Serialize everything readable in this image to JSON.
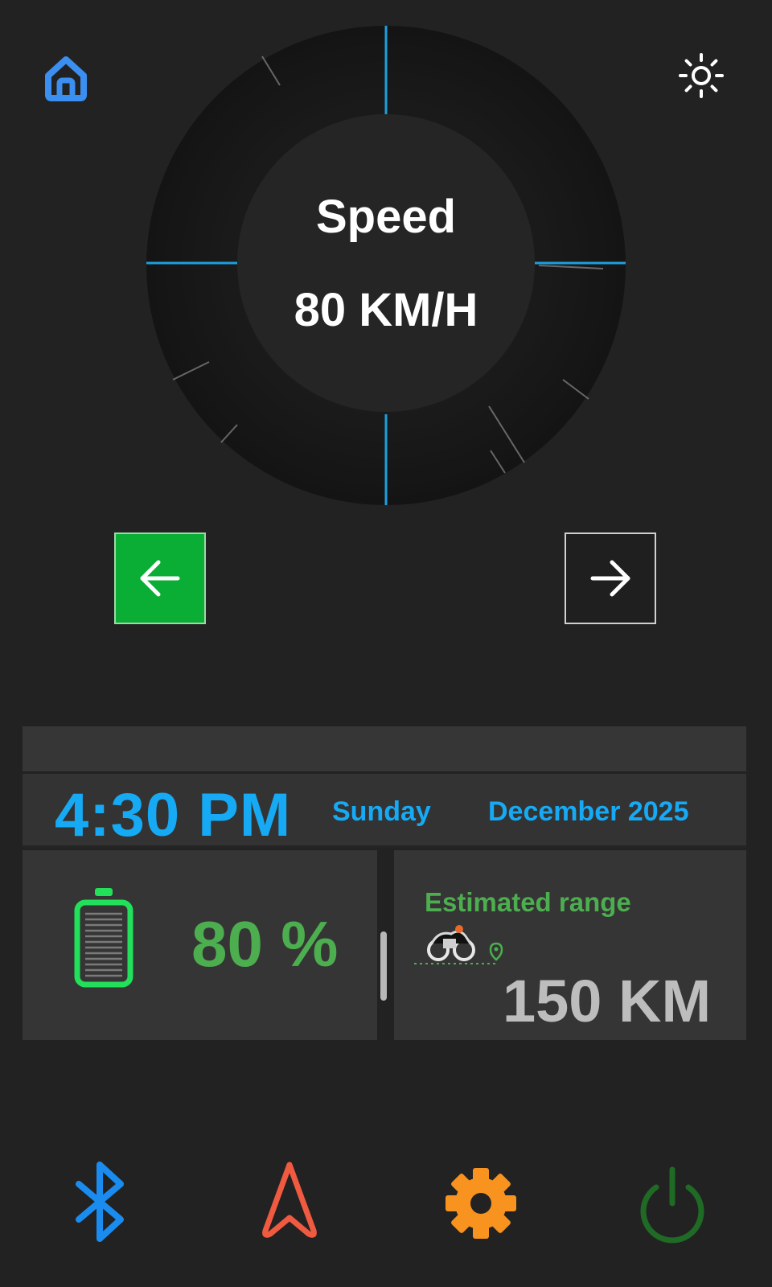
{
  "header": {
    "home_icon": "home-icon",
    "brightness_icon": "sun-icon",
    "accent": "#3b8ff0"
  },
  "speedometer": {
    "label": "Speed",
    "value": "80 KM/H",
    "tick_color": "#1aa0e0"
  },
  "turn_signals": {
    "left": {
      "icon": "arrow-left-icon",
      "active": true,
      "color": "#0aae35"
    },
    "right": {
      "icon": "arrow-right-icon",
      "active": false
    }
  },
  "clock": {
    "time": "4:30 PM",
    "day": "Sunday",
    "date": "December 2025",
    "color": "#16aaf5"
  },
  "battery": {
    "icon": "battery-icon",
    "value": "80 %",
    "level": 0.8,
    "color": "#4cae4f"
  },
  "range": {
    "label": "Estimated range",
    "icon": "motorcycle-icon",
    "value": "150 KM"
  },
  "bottom_bar": {
    "bluetooth": {
      "icon": "bluetooth-icon",
      "color": "#1a8cf0"
    },
    "navigation": {
      "icon": "navigation-arrow-icon",
      "color": "#f05a40"
    },
    "settings": {
      "icon": "gear-icon",
      "color": "#f7931e"
    },
    "power": {
      "icon": "power-icon",
      "color": "#1f6a25"
    }
  }
}
